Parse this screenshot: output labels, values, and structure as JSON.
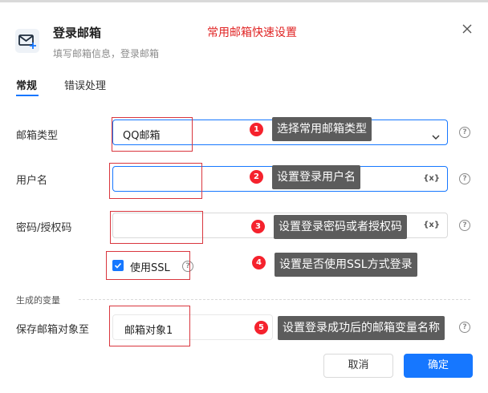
{
  "header": {
    "title": "登录邮箱",
    "subtitle": "填写邮箱信息，登录邮箱",
    "annotation_title": "常用邮箱快速设置"
  },
  "tabs": [
    {
      "label": "常规",
      "active": true
    },
    {
      "label": "错误处理",
      "active": false
    }
  ],
  "form": {
    "mail_type": {
      "label": "邮箱类型",
      "value": "QQ邮箱"
    },
    "username": {
      "label": "用户名",
      "value": ""
    },
    "password": {
      "label": "密码/授权码",
      "value": ""
    },
    "use_ssl": {
      "label": "使用SSL",
      "checked": true
    },
    "variable_marker": "{x}",
    "help_glyph": "?"
  },
  "output": {
    "section_label": "生成的变量",
    "save_label": "保存邮箱对象至",
    "value": "邮箱对象1"
  },
  "annotations": [
    {
      "number": "1",
      "text": "选择常用邮箱类型"
    },
    {
      "number": "2",
      "text": "设置登录用户名"
    },
    {
      "number": "3",
      "text": "设置登录密码或者授权码"
    },
    {
      "number": "4",
      "text": "设置是否使用SSL方式登录"
    },
    {
      "number": "5",
      "text": "设置登录成功后的邮箱变量名称"
    }
  ],
  "footer": {
    "cancel_label": "取消",
    "ok_label": "确定"
  },
  "colors": {
    "primary": "#1677ff",
    "annotation_red": "#e02424",
    "tooltip_bg": "#5c5c5c"
  },
  "icons": {
    "app": "mail-plus-icon",
    "close": "close-icon",
    "dropdown": "chevron-down-icon",
    "help": "question-circle-icon",
    "check": "check-icon"
  }
}
